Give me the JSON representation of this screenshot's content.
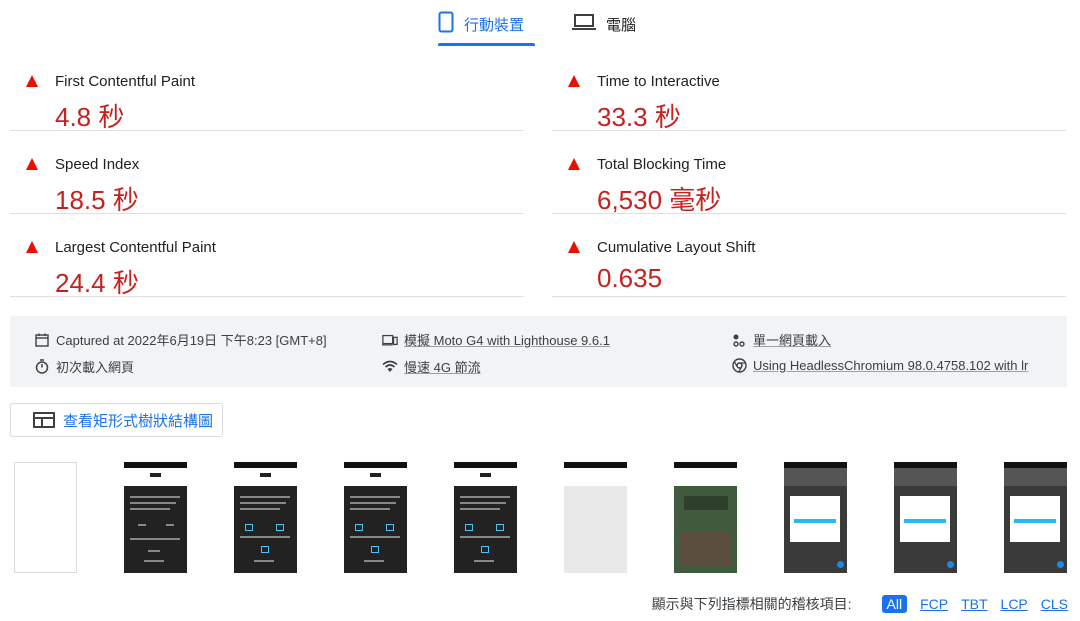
{
  "tabs": {
    "mobile": "行動裝置",
    "desktop": "電腦"
  },
  "metrics": {
    "fcp": {
      "label": "First Contentful Paint",
      "value": "4.8 秒"
    },
    "tti": {
      "label": "Time to Interactive",
      "value": "33.3 秒"
    },
    "si": {
      "label": "Speed Index",
      "value": "18.5 秒"
    },
    "tbt": {
      "label": "Total Blocking Time",
      "value": "6,530 毫秒"
    },
    "lcp": {
      "label": "Largest Contentful Paint",
      "value": "24.4 秒"
    },
    "cls": {
      "label": "Cumulative Layout Shift",
      "value": "0.635"
    }
  },
  "info": {
    "captured": "Captured at 2022年6月19日 下午8:23 [GMT+8]",
    "device": "模擬 Moto G4 with Lighthouse 9.6.1",
    "session": "單一網頁載入",
    "load": "初次載入網頁",
    "throttle": "慢速 4G 節流",
    "browser": "Using HeadlessChromium 98.0.4758.102 with lr"
  },
  "treemap_label": "查看矩形式樹狀結構圖",
  "filter": {
    "label": "顯示與下列指標相關的稽核項目:",
    "chips": [
      "All",
      "FCP",
      "TBT",
      "LCP",
      "CLS"
    ]
  },
  "colors": {
    "accent": "#1a73e8",
    "fail": "#c5221f",
    "fail_icon": "#eb0f00"
  },
  "icons": {
    "mobile": "smartphone-icon",
    "desktop": "laptop-icon",
    "fail": "red-triangle-icon",
    "calendar": "calendar-icon",
    "device": "device-icon",
    "session": "person-dots-icon",
    "timer": "stopwatch-icon",
    "network": "wifi-icon",
    "chrome": "chrome-icon",
    "treemap": "treemap-icon"
  }
}
